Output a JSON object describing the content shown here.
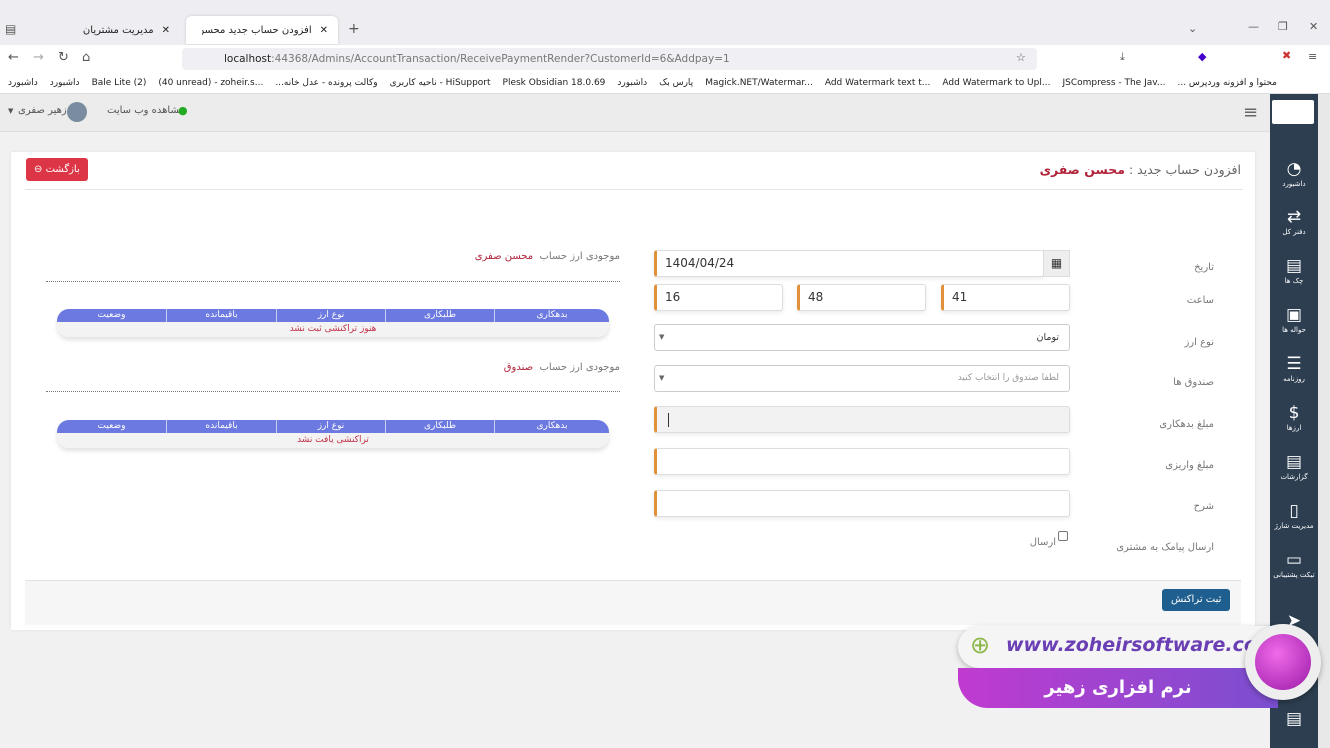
{
  "browser": {
    "tabs": [
      {
        "label": "مدیریت مشتریان"
      },
      {
        "label": "افزودن حساب جدید محسن صفری"
      }
    ],
    "url_host": "localhost",
    "url_rest": ":44368/Admins/AccountTransaction/ReceivePaymentRender?CustomerId=6&Addpay=1",
    "bookmarks": [
      "داشبورد",
      "داشبورد",
      "Bale Lite (2)",
      "(40 unread) - zoheir.s...",
      "...وکالت پرونده - عدل خانه",
      "ناحیه کاربری - HiSupport",
      "Plesk Obsidian 18.0.69",
      "داشبورد",
      "پارس بک",
      "Magick.NET/Watermar...",
      "Add Watermark text t...",
      "Add Watermark to Upl...",
      "JSCompress - The Jav...",
      "... محتوا و افزونه وردپرس"
    ]
  },
  "appbar": {
    "user": "زهیر صفری",
    "view_site": "مشاهده وب سایت"
  },
  "sidebar": {
    "items": [
      "داشبورد",
      "دفتر کل",
      "چک ها",
      "حواله ها",
      "روزنامه",
      "ارزها",
      "گزارشات",
      "مدیریت شارژ",
      "تیکت پشتیبانی"
    ]
  },
  "page": {
    "title_prefix": "افزودن حساب جدید :",
    "title_name": "محسن صفری",
    "back": "بازگشت",
    "form": {
      "date_label": "تاریخ",
      "date": "1404/04/24",
      "time_label": "ساعت",
      "hour": "16",
      "minute": "48",
      "second": "41",
      "currency_label": "نوع ارز",
      "currency": "تومان",
      "box_label": "صندوق ها",
      "box_placeholder": "لطفا صندوق را انتخاب کنید",
      "debit_label": "مبلغ بدهکاری",
      "deposit_label": "مبلغ واریزی",
      "desc_label": "شرح",
      "sms_label": "ارسال پیامک به مشتری",
      "sms_check": "ارسال",
      "submit": "ثبت تراکنش"
    },
    "balances": [
      {
        "prefix": "موجودی ارز حساب",
        "name": "محسن صفری",
        "empty": "هنوز تراکنشی ثبت نشد"
      },
      {
        "prefix": "موجودی ارز حساب",
        "name": "صندوق",
        "empty": "تراکنشی یافت نشد"
      }
    ],
    "table_headers": [
      "بدهکاری",
      "طلبکاری",
      "نوع ارز",
      "باقیمانده",
      "وضعیت"
    ]
  },
  "watermark": {
    "url": "www.zoheirsoftware.com",
    "brand": "نرم افزاری زهیر"
  }
}
